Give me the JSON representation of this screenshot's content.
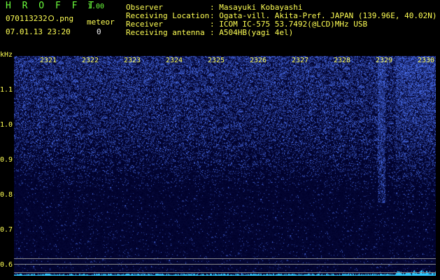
{
  "header": {
    "app_title": "H R O F F T",
    "version": "1.00",
    "filename": "070113232Ｏ.png",
    "datetime": "07.01.13 23:20",
    "meteor_label": "meteor",
    "meteor_count": "0"
  },
  "info": [
    {
      "key": "Observer",
      "value": ": Masayuki Kobayashi"
    },
    {
      "key": "Receiving Location",
      "value": ": Ogata-vill. Akita-Pref. JAPAN (139.96E, 40.02N)"
    },
    {
      "key": "Receiver",
      "value": ": ICOM IC-575 53.7492(@LCD)MHz USB"
    },
    {
      "key": "Receiving antenna",
      "value": ": A504HB(yagi 4el)"
    }
  ],
  "axis": {
    "y_unit": "kHz",
    "y_ticks": [
      "1.1",
      "1.0",
      "0.9",
      "0.8",
      "0.7",
      "0.6"
    ],
    "x_ticks": [
      "2321",
      "2322",
      "2323",
      "2324",
      "2325",
      "2326",
      "2327",
      "2328",
      "2329",
      "2330"
    ]
  },
  "colors": {
    "background": "#000000",
    "label_yellow": "#ffff54",
    "label_green": "#6cff3c",
    "spectrum_blue": "#1a2cff"
  }
}
